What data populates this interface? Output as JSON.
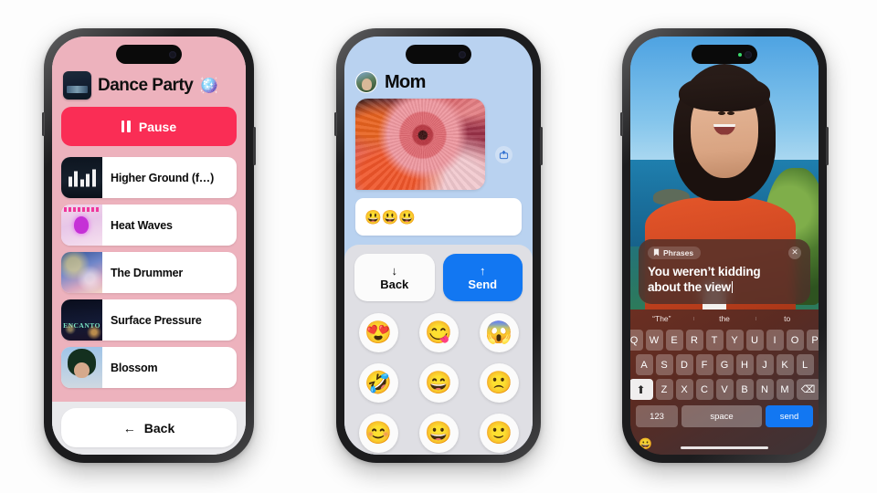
{
  "phone1": {
    "app": "music-playlist",
    "background_color": "#EDB2BD",
    "bottom_color": "#E9E9EC",
    "header": {
      "title": "Dance Party",
      "icon": "album-art",
      "trailing_emoji": "🪩"
    },
    "pause_button": {
      "label": "Pause",
      "color": "#FA2D55"
    },
    "songs": [
      {
        "title": "Higher Ground (f…)",
        "art": "higher"
      },
      {
        "title": "Heat Waves",
        "art": "heat"
      },
      {
        "title": "The Drummer",
        "art": "drummer"
      },
      {
        "title": "Surface Pressure",
        "art": "encanto"
      },
      {
        "title": "Blossom",
        "art": "blossom"
      }
    ],
    "back_button": {
      "label": "Back",
      "arrow": "←"
    }
  },
  "phone2": {
    "app": "messages",
    "background_color": "#B9D2F0",
    "tray_color": "#DFDFE4",
    "header": {
      "contact": "Mom",
      "avatar": "contact-photo"
    },
    "message": {
      "type": "photo",
      "description": "dahlia-flower-photo",
      "save_icon": "save-to-photos"
    },
    "input": {
      "value": "😃😃😃",
      "placeholder": ""
    },
    "actions": {
      "back": {
        "label": "Back",
        "arrow": "↓"
      },
      "send": {
        "label": "Send",
        "arrow": "↑",
        "color": "#1277F2"
      }
    },
    "emoji_grid": [
      "😍",
      "😋",
      "😱",
      "🤣",
      "😄",
      "🙁",
      "😊",
      "😀",
      "🙂"
    ]
  },
  "phone3": {
    "app": "facetime-live-captions",
    "video": {
      "subject": "woman-on-coastal-cliff"
    },
    "phrases_panel": {
      "badge": "Phrases",
      "badge_icon": "bookmark-icon",
      "close_icon": "✕",
      "text_line1": "You weren’t kidding",
      "text_line2": "about the view"
    },
    "keyboard": {
      "predictions": [
        "“The”",
        "the",
        "to"
      ],
      "row1": [
        "Q",
        "W",
        "E",
        "R",
        "T",
        "Y",
        "U",
        "I",
        "O",
        "P"
      ],
      "row2": [
        "A",
        "S",
        "D",
        "F",
        "G",
        "H",
        "J",
        "K",
        "L"
      ],
      "row3": [
        "Z",
        "X",
        "C",
        "V",
        "B",
        "N",
        "M"
      ],
      "shift_icon": "⬆",
      "delete_icon": "⌫",
      "numbers_key": "123",
      "space_key": "space",
      "send_key": "send",
      "emoji_key": "😀"
    }
  }
}
